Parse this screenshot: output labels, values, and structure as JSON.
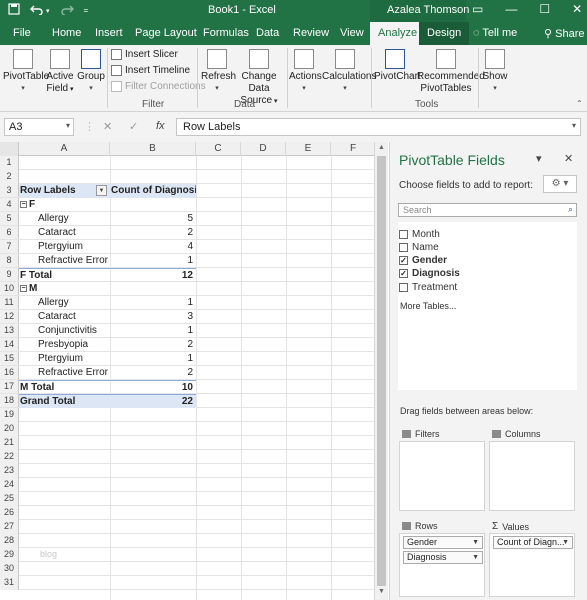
{
  "titlebar": {
    "title": "Book1 - Excel",
    "user": "Azalea Thomson",
    "save_icon": "save-icon",
    "undo_icon": "undo-icon",
    "redo_icon": "redo-icon",
    "minimize": "—",
    "restore": "☐",
    "close": "✕",
    "ribbon_display": "▭"
  },
  "tabs": {
    "file": "File",
    "home": "Home",
    "insert": "Insert",
    "page_layout": "Page Layout",
    "formulas": "Formulas",
    "data": "Data",
    "review": "Review",
    "view": "View",
    "analyze": "Analyze",
    "design": "Design",
    "tell_me": "Tell me",
    "share": "Share"
  },
  "ribbon": {
    "pivottable": "PivotTable",
    "active_field_1": "Active",
    "active_field_2": "Field",
    "group": "Group",
    "insert_slicer": "Insert Slicer",
    "insert_timeline": "Insert Timeline",
    "filter_connections": "Filter Connections",
    "filter_group": "Filter",
    "refresh": "Refresh",
    "change_data_source_1": "Change Data",
    "change_data_source_2": "Source",
    "data_group": "Data",
    "actions": "Actions",
    "calculations": "Calculations",
    "pivotchart": "PivotChart",
    "recommended_1": "Recommended",
    "recommended_2": "PivotTables",
    "tools_group": "Tools",
    "show": "Show"
  },
  "formula_bar": {
    "name_box": "A3",
    "formula": "Row Labels",
    "cancel": "✕",
    "enter": "✓",
    "fx": "fx"
  },
  "grid": {
    "columns": [
      "A",
      "B",
      "C",
      "D",
      "E",
      "F"
    ],
    "row_numbers": [
      "1",
      "2",
      "3",
      "4",
      "5",
      "6",
      "7",
      "8",
      "9",
      "10",
      "11",
      "12",
      "13",
      "14",
      "15",
      "16",
      "17",
      "18",
      "19",
      "20",
      "21",
      "22",
      "23",
      "24",
      "25",
      "26",
      "27",
      "28",
      "29",
      "30",
      "31"
    ],
    "pivot": {
      "header_label": "Row Labels",
      "header_value": "Count of Diagnosis",
      "group_f": "F",
      "f_items": [
        {
          "label": "Allergy",
          "value": "5"
        },
        {
          "label": "Cataract",
          "value": "2"
        },
        {
          "label": "Ptergyium",
          "value": "4"
        },
        {
          "label": "Refractive Error",
          "value": "1"
        }
      ],
      "f_total_label": "F Total",
      "f_total_value": "12",
      "group_m": "M",
      "m_items": [
        {
          "label": "Allergy",
          "value": "1"
        },
        {
          "label": "Cataract",
          "value": "3"
        },
        {
          "label": "Conjunctivitis",
          "value": "1"
        },
        {
          "label": "Presbyopia",
          "value": "2"
        },
        {
          "label": "Ptergyium",
          "value": "1"
        },
        {
          "label": "Refractive Error",
          "value": "2"
        }
      ],
      "m_total_label": "M Total",
      "m_total_value": "10",
      "grand_total_label": "Grand Total",
      "grand_total_value": "22"
    },
    "watermark": "blog"
  },
  "panel": {
    "title": "PivotTable Fields",
    "subtitle": "Choose fields to add to report:",
    "search_placeholder": "Search",
    "fields": [
      {
        "label": "Month",
        "checked": false
      },
      {
        "label": "Name",
        "checked": false
      },
      {
        "label": "Gender",
        "checked": true
      },
      {
        "label": "Diagnosis",
        "checked": true
      },
      {
        "label": "Treatment",
        "checked": false
      }
    ],
    "more_tables": "More Tables...",
    "drag_text": "Drag fields between areas below:",
    "filters_label": "Filters",
    "columns_label": "Columns",
    "rows_label": "Rows",
    "values_label": "Values",
    "rows_items": [
      "Gender",
      "Diagnosis"
    ],
    "values_items": [
      "Count of Diagn..."
    ]
  }
}
